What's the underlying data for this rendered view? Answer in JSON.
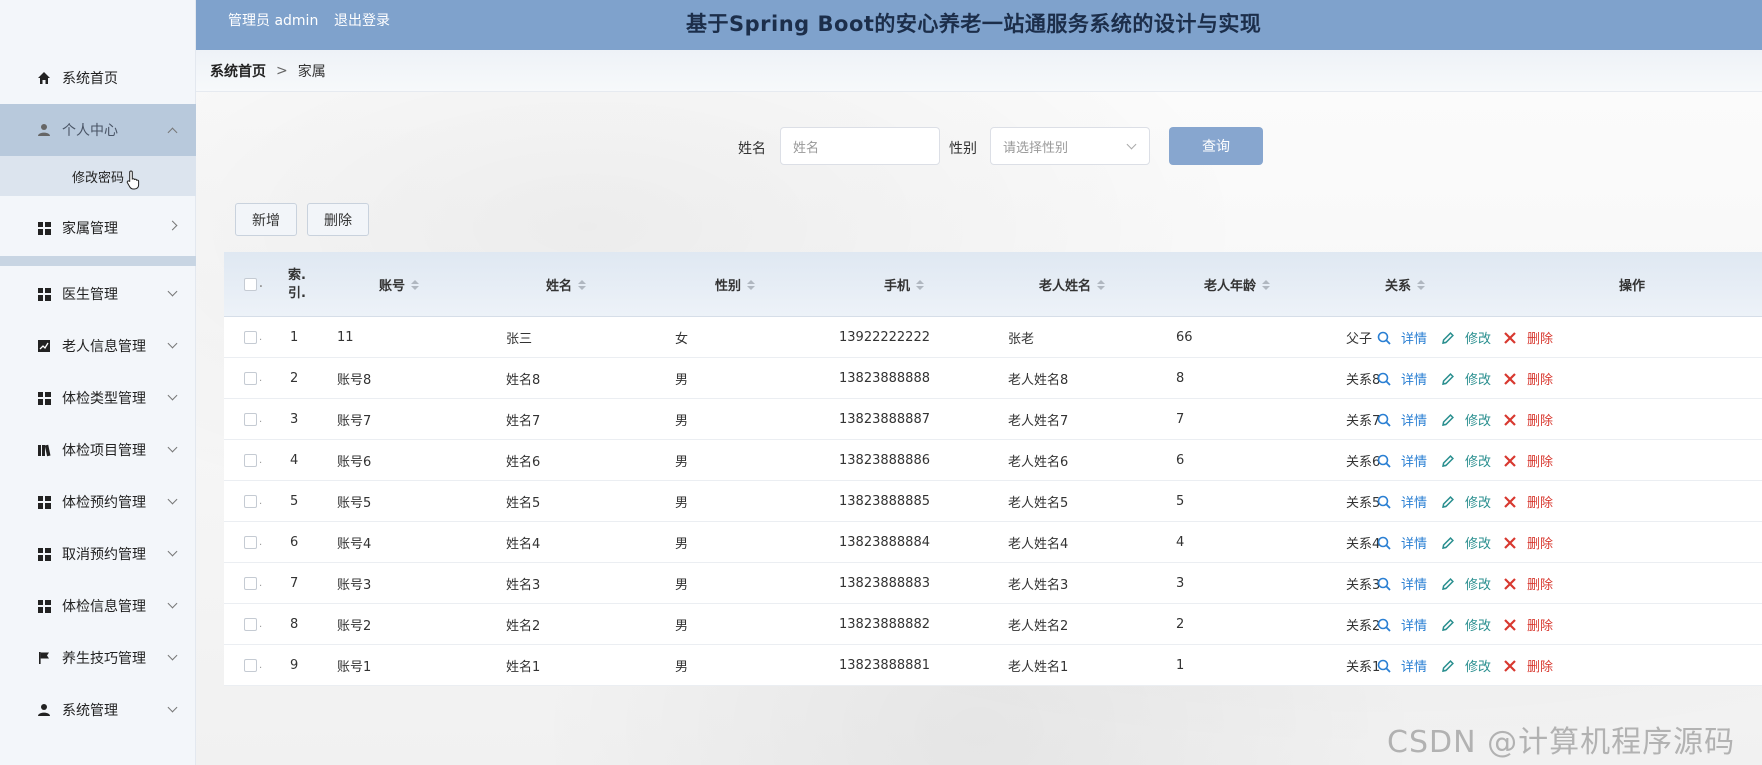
{
  "header": {
    "user": "管理员 admin",
    "logout": "退出登录",
    "title": "基于Spring Boot的安心养老一站通服务系统的设计与实现"
  },
  "breadcrumb": {
    "home": "系统首页",
    "separator": ">",
    "current": "家属"
  },
  "sidebar": {
    "items": [
      {
        "label": "系统首页",
        "icon": "home-icon"
      },
      {
        "label": "个人中心",
        "icon": "user-icon"
      },
      {
        "label": "家属管理",
        "icon": "grid-icon"
      },
      {
        "label": "医生管理",
        "icon": "grid-icon"
      },
      {
        "label": "老人信息管理",
        "icon": "chart-icon"
      },
      {
        "label": "体检类型管理",
        "icon": "grid-icon"
      },
      {
        "label": "体检项目管理",
        "icon": "book-icon"
      },
      {
        "label": "体检预约管理",
        "icon": "grid-icon"
      },
      {
        "label": "取消预约管理",
        "icon": "grid-icon"
      },
      {
        "label": "体检信息管理",
        "icon": "grid-icon"
      },
      {
        "label": "养生技巧管理",
        "icon": "flag-icon"
      },
      {
        "label": "系统管理",
        "icon": "user-icon"
      }
    ],
    "submenu": {
      "label": "修改密码"
    }
  },
  "search": {
    "name_label": "姓名",
    "name_placeholder": "姓名",
    "gender_label": "性别",
    "gender_placeholder": "请选择性别",
    "query_button": "查询"
  },
  "toolbar": {
    "add_label": "新增",
    "delete_label": "删除"
  },
  "table": {
    "headers": {
      "index": "索.\n引.",
      "account": "账号",
      "name": "姓名",
      "gender": "性别",
      "phone": "手机",
      "elder_name": "老人姓名",
      "elder_age": "老人年龄",
      "relation": "关系",
      "actions": "操作"
    },
    "action_labels": {
      "detail": "详情",
      "edit": "修改",
      "delete": "删除"
    },
    "rows": [
      {
        "index": "1",
        "account": "11",
        "name": "张三",
        "gender": "女",
        "phone": "13922222222",
        "elder_name": "张老",
        "elder_age": "66",
        "relation": "父子"
      },
      {
        "index": "2",
        "account": "账号8",
        "name": "姓名8",
        "gender": "男",
        "phone": "13823888888",
        "elder_name": "老人姓名8",
        "elder_age": "8",
        "relation": "关系8"
      },
      {
        "index": "3",
        "account": "账号7",
        "name": "姓名7",
        "gender": "男",
        "phone": "13823888887",
        "elder_name": "老人姓名7",
        "elder_age": "7",
        "relation": "关系7"
      },
      {
        "index": "4",
        "account": "账号6",
        "name": "姓名6",
        "gender": "男",
        "phone": "13823888886",
        "elder_name": "老人姓名6",
        "elder_age": "6",
        "relation": "关系6"
      },
      {
        "index": "5",
        "account": "账号5",
        "name": "姓名5",
        "gender": "男",
        "phone": "13823888885",
        "elder_name": "老人姓名5",
        "elder_age": "5",
        "relation": "关系5"
      },
      {
        "index": "6",
        "account": "账号4",
        "name": "姓名4",
        "gender": "男",
        "phone": "13823888884",
        "elder_name": "老人姓名4",
        "elder_age": "4",
        "relation": "关系4"
      },
      {
        "index": "7",
        "account": "账号3",
        "name": "姓名3",
        "gender": "男",
        "phone": "13823888883",
        "elder_name": "老人姓名3",
        "elder_age": "3",
        "relation": "关系3"
      },
      {
        "index": "8",
        "account": "账号2",
        "name": "姓名2",
        "gender": "男",
        "phone": "13823888882",
        "elder_name": "老人姓名2",
        "elder_age": "2",
        "relation": "关系2"
      },
      {
        "index": "9",
        "account": "账号1",
        "name": "姓名1",
        "gender": "男",
        "phone": "13823888881",
        "elder_name": "老人姓名1",
        "elder_age": "1",
        "relation": "关系1"
      }
    ]
  },
  "watermark": "CSDN @计算机程序源码",
  "colors": {
    "header_bg": "#7fa2cc",
    "active_menu": "#b8c9dc",
    "query_button": "#87a6cf",
    "detail": "#2a7fd3",
    "edit": "#2a8f8f",
    "delete": "#d8382f"
  }
}
